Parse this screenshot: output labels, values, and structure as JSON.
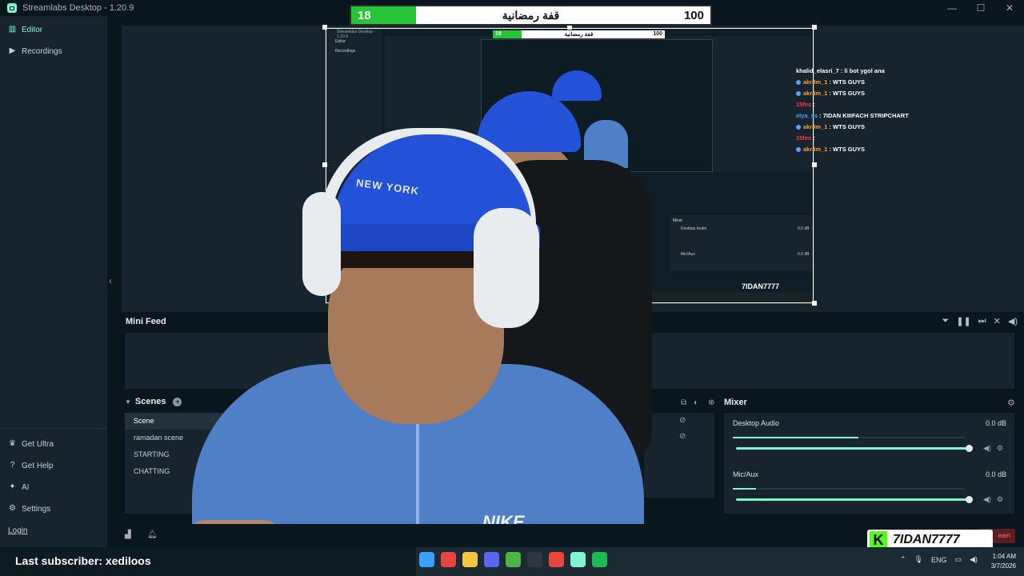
{
  "app": {
    "title": "Streamlabs Desktop - 1.20.9"
  },
  "window_controls": {
    "minimize": "—",
    "maximize": "☐",
    "close": "✕"
  },
  "sidebar": {
    "items": [
      {
        "label": "Editor",
        "icon": "editor-icon"
      },
      {
        "label": "Recordings",
        "icon": "recordings-icon"
      }
    ],
    "bottom_items": [
      {
        "label": "Get Ultra",
        "icon": "ultra-icon"
      },
      {
        "label": "Get Help",
        "icon": "help-icon"
      },
      {
        "label": "AI",
        "icon": "ai-sparkle-icon"
      },
      {
        "label": "Settings",
        "icon": "gear-icon"
      }
    ],
    "login": "Login"
  },
  "overlay": {
    "goal_current": "18",
    "goal_title": "قفة رمضانية",
    "goal_target": "100",
    "goal_progress": 0.18,
    "goal_color": "#27c43a",
    "chat": [
      {
        "user": "khalid_elasri_7",
        "message": ": li bot ygol ana",
        "color": "#ffffff",
        "badge": false
      },
      {
        "user": "akr4m_1",
        "message": ": WTS GUYS",
        "color": "#ff9f2e",
        "badge": true
      },
      {
        "user": "akr4m_1",
        "message": ": WTS GUYS",
        "color": "#ff9f2e",
        "badge": true
      },
      {
        "user": "15fes",
        "message": ":",
        "color": "#ff3b3b",
        "badge": false
      },
      {
        "user": "elya_ss",
        "message": ": 7IDAN KIIIFACH STRIPCHART",
        "color": "#3ea6ff",
        "badge": false
      },
      {
        "user": "akr4m_1",
        "message": ": WTS GUYS",
        "color": "#ff9f2e",
        "badge": true
      },
      {
        "user": "15fes",
        "message": ":",
        "color": "#ff3b3b",
        "badge": false
      },
      {
        "user": "akr4m_1",
        "message": ": WTS GUYS",
        "color": "#ff9f2e",
        "badge": true
      }
    ],
    "nested_brand": "7IDAN7777",
    "nested_title": "Streamlabs Desktop - 1.20.9",
    "nested_nav": [
      "Editor",
      "Recordings"
    ],
    "nested_mixer": "Mixer",
    "nested_channels": [
      "Desktop Audio",
      "Mic/Aux"
    ],
    "nested_db": "0.0 dB",
    "cap_text": "NEW YORK",
    "jacket_text": "NIKE"
  },
  "mini_feed": {
    "title": "Mini Feed",
    "icons": [
      "filter-icon",
      "pause-icon",
      "skip-icon",
      "mute-alerts-icon",
      "volume-icon"
    ]
  },
  "scenes": {
    "title": "Scenes",
    "add_icon": "+",
    "items": [
      "Scene",
      "ramadan scene",
      "STARTING",
      "CHATTING"
    ],
    "active_index": 0
  },
  "mixer": {
    "title": "Mixer",
    "channels": [
      {
        "name": "Desktop Audio",
        "db": "0.0 dB",
        "level": 0.54,
        "volume": 1.0
      },
      {
        "name": "Mic/Aux",
        "db": "0.0 dB",
        "level": 0.1,
        "volume": 1.0
      }
    ]
  },
  "footer": {
    "go_live": "eam"
  },
  "brand": {
    "k": "K",
    "name": "7IDAN7777"
  },
  "subscriber": {
    "text": "Last subscriber: xediloos"
  },
  "taskbar": {
    "apps": [
      {
        "icon": "windows-start-icon",
        "color": "#3aa0ff"
      },
      {
        "icon": "chrome-icon",
        "color": "#e8453c"
      },
      {
        "icon": "file-explorer-icon",
        "color": "#f5c542"
      },
      {
        "icon": "discord-icon",
        "color": "#5865f2"
      },
      {
        "icon": "utorrent-icon",
        "color": "#4bb543"
      },
      {
        "icon": "obs-icon",
        "color": "#30363d"
      },
      {
        "icon": "chrome-icon-2",
        "color": "#e8453c"
      },
      {
        "icon": "streamlabs-icon",
        "color": "#80f5d2"
      },
      {
        "icon": "spotify-icon",
        "color": "#1db954"
      }
    ],
    "language": "ENG",
    "time": "1:04 AM",
    "date": "3/7/2026"
  },
  "colors": {
    "accent": "#80f5d2",
    "panel": "#17242d",
    "background": "#09161d"
  }
}
